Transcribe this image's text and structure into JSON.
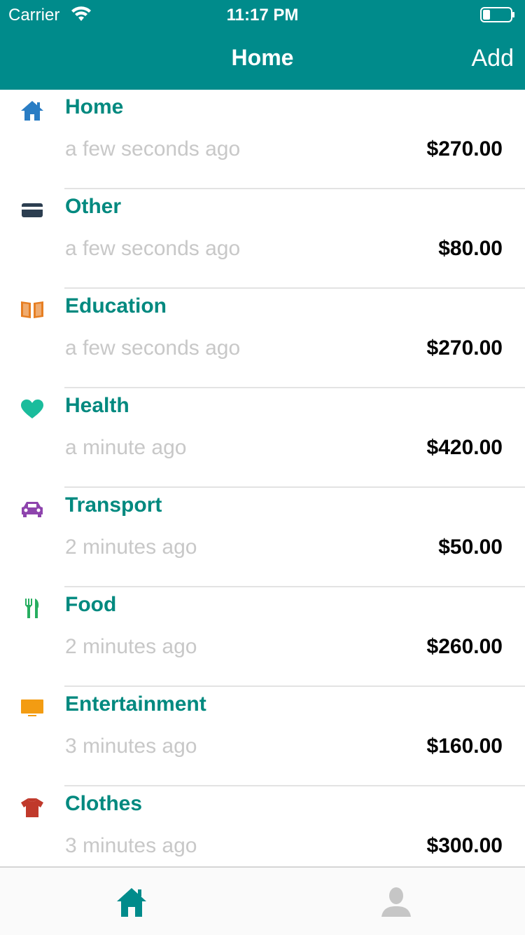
{
  "status_bar": {
    "carrier": "Carrier",
    "time": "11:17 PM"
  },
  "nav": {
    "title": "Home",
    "add_label": "Add"
  },
  "colors": {
    "primary": "#008B8B",
    "category_text": "#00897f",
    "timestamp": "#c8c8c8"
  },
  "expenses": [
    {
      "category": "Home",
      "time": "a few seconds ago",
      "amount": "$270.00",
      "icon": "home-icon",
      "icon_color": "#2a7dc4"
    },
    {
      "category": "Other",
      "time": "a few seconds ago",
      "amount": "$80.00",
      "icon": "credit-card-icon",
      "icon_color": "#2c3e50"
    },
    {
      "category": "Education",
      "time": "a few seconds ago",
      "amount": "$270.00",
      "icon": "book-icon",
      "icon_color": "#e67e22"
    },
    {
      "category": "Health",
      "time": "a minute ago",
      "amount": "$420.00",
      "icon": "heart-icon",
      "icon_color": "#1abc9c"
    },
    {
      "category": "Transport",
      "time": "2 minutes ago",
      "amount": "$50.00",
      "icon": "car-icon",
      "icon_color": "#8e44ad"
    },
    {
      "category": "Food",
      "time": "2 minutes ago",
      "amount": "$260.00",
      "icon": "cutlery-icon",
      "icon_color": "#27ae60"
    },
    {
      "category": "Entertainment",
      "time": "3 minutes ago",
      "amount": "$160.00",
      "icon": "tv-icon",
      "icon_color": "#f39c12"
    },
    {
      "category": "Clothes",
      "time": "3 minutes ago",
      "amount": "$300.00",
      "icon": "tshirt-icon",
      "icon_color": "#c0392b"
    }
  ],
  "tabbar": {
    "home_icon": "home-tab-icon",
    "home_color": "#008B8B",
    "profile_icon": "profile-tab-icon",
    "profile_color": "#c6c6c6"
  }
}
